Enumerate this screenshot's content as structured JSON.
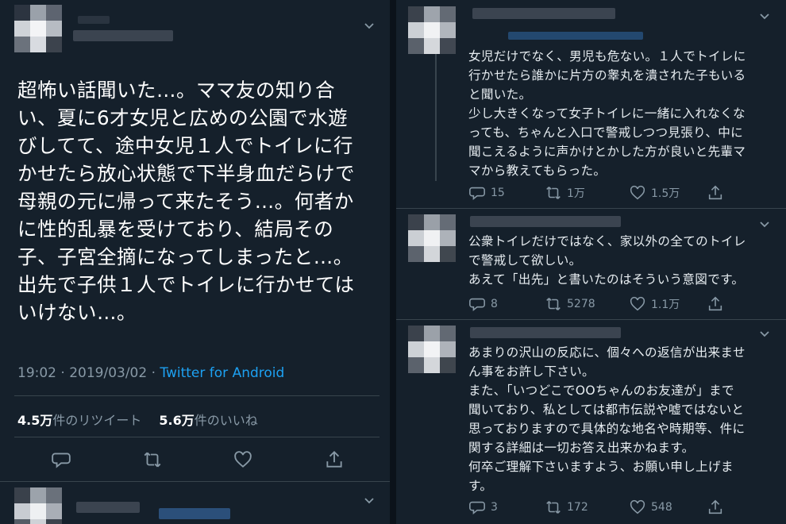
{
  "colors": {
    "background": "#15202b",
    "text": "#e6ecf0",
    "secondary": "#8899a6",
    "accent": "#1da1f2"
  },
  "main_tweet": {
    "text_lines": [
      "超怖い話聞いた…。ママ友の知り合",
      "い、夏に6才女児と広めの公園で水遊",
      "びしてて、途中女児１人でトイレに行",
      "かせたら放心状態で下半身血だらけで",
      "母親の元に帰って来たそう…。何者か",
      "に性的乱暴を受けており、結局その",
      "子、子宮全摘になってしまったと…。",
      "出先で子供１人でトイレに行かせては",
      "いけない…。"
    ],
    "timestamp": "19:02 · 2019/03/02 · ",
    "source": "Twitter for Android",
    "retweet_count": "4.5万",
    "retweet_label": "件のリツイート",
    "like_count": "5.6万",
    "like_label": "件のいいね"
  },
  "replies": [
    {
      "text_lines": [
        "女児だけでなく、男児も危ない。１人でトイレに",
        "行かせたら誰かに片方の睾丸を潰された子もいる",
        "と聞いた。",
        "少し大きくなって女子トイレに一緒に入れなくな",
        "っても、ちゃんと入口で警戒しつつ見張り、中に",
        "聞こえるように声かけとかした方が良いと先輩マ",
        "マから教えてもらった。"
      ],
      "replies": "15",
      "retweets": "1万",
      "likes": "1.5万"
    },
    {
      "text_lines": [
        "公衆トイレだけではなく、家以外の全てのトイレ",
        "で警戒して欲しい。",
        "あえて「出先」と書いたのはそういう意図です。"
      ],
      "replies": "8",
      "retweets": "5278",
      "likes": "1.1万"
    },
    {
      "text_lines": [
        "あまりの沢山の反応に、個々への返信が出来ませ",
        "ん事をお許し下さい。",
        "また、「いつどこでOOちゃんのお友達が」まで",
        "聞いており、私としては都市伝説や嘘ではないと",
        "思っておりますので具体的な地名や時期等、件に",
        "関する詳細は一切お答え出来かねます。",
        "何卒ご理解下さいますよう、お願い申し上げま",
        "す。"
      ],
      "replies": "3",
      "retweets": "172",
      "likes": "548"
    }
  ]
}
